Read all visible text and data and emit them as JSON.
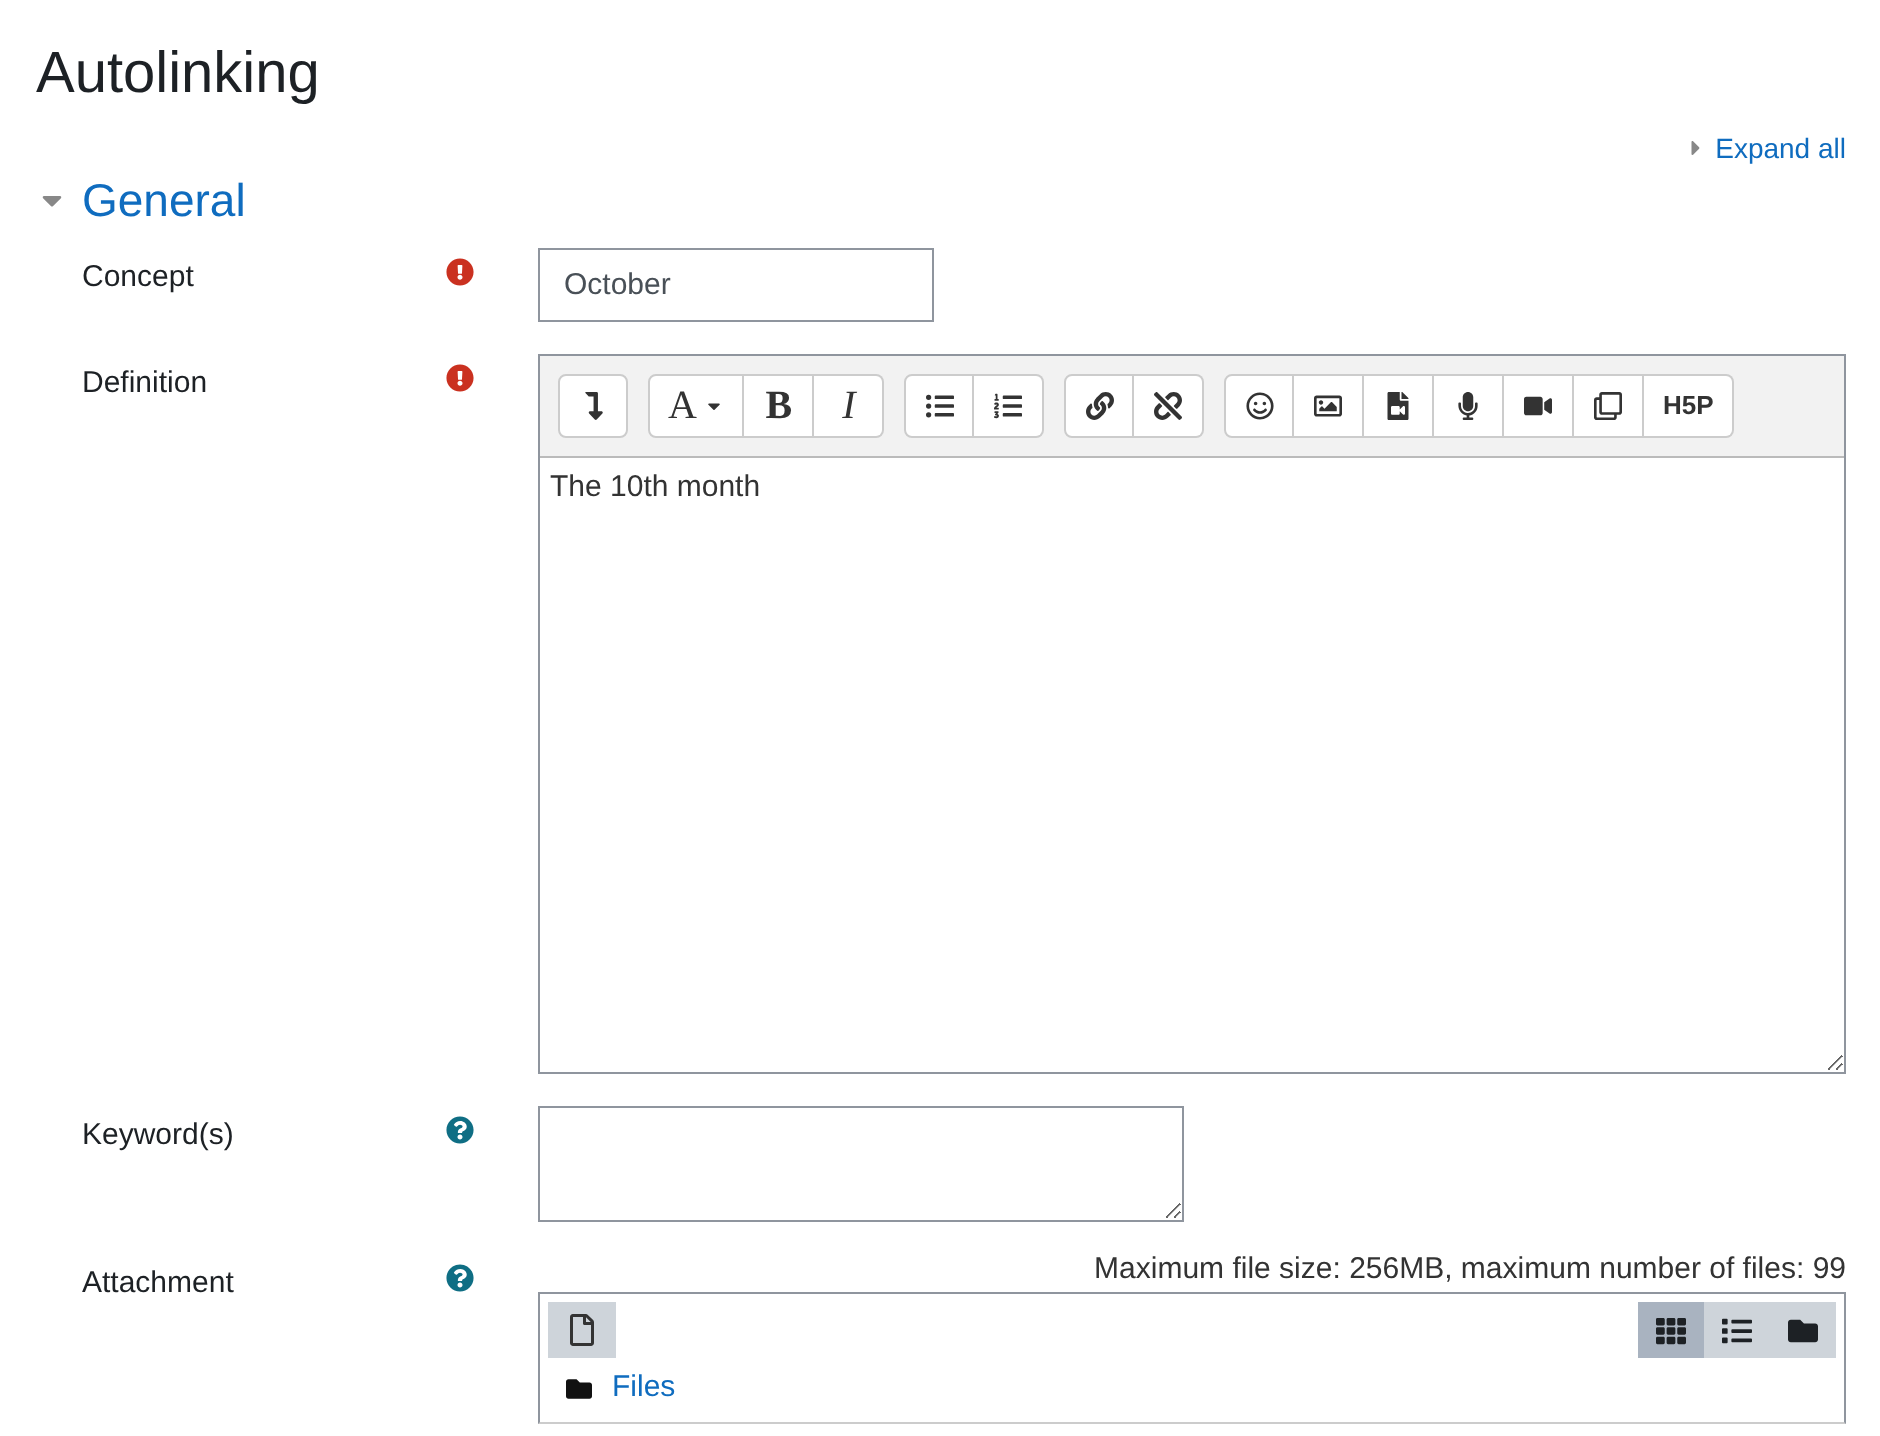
{
  "page_title": "Autolinking",
  "expand_all": "Expand all",
  "section": {
    "title": "General",
    "expanded": true
  },
  "fields": [
    {
      "kind": "text",
      "label": "Concept",
      "required": true,
      "value": "October"
    },
    {
      "kind": "editor",
      "label": "Definition",
      "required": true,
      "value": "The 10th month",
      "toolbar": [
        {
          "buttons": [
            {
              "kind": "icon"
            }
          ]
        },
        {
          "buttons": [
            {
              "kind": "menu",
              "label": "A"
            },
            {
              "kind": "text",
              "label": "B"
            },
            {
              "kind": "text",
              "label": "I"
            }
          ]
        },
        {
          "buttons": [
            {
              "kind": "icon"
            },
            {
              "kind": "icon"
            }
          ]
        },
        {
          "buttons": [
            {
              "kind": "icon"
            },
            {
              "kind": "icon"
            }
          ]
        },
        {
          "buttons": [
            {
              "kind": "icon"
            },
            {
              "kind": "icon"
            },
            {
              "kind": "icon"
            },
            {
              "kind": "icon"
            },
            {
              "kind": "icon"
            },
            {
              "kind": "icon"
            },
            {
              "kind": "text",
              "label": "H5P"
            }
          ]
        }
      ]
    },
    {
      "kind": "textarea",
      "label": "Keyword(s)",
      "required": false
    },
    {
      "kind": "files",
      "label": "Attachment",
      "required": false,
      "note": "Maximum file size: 256MB, maximum number of files: 99",
      "folder": "Files",
      "views": [
        {
          "selected": true
        },
        {
          "selected": false
        },
        {
          "selected": false
        }
      ]
    }
  ]
}
